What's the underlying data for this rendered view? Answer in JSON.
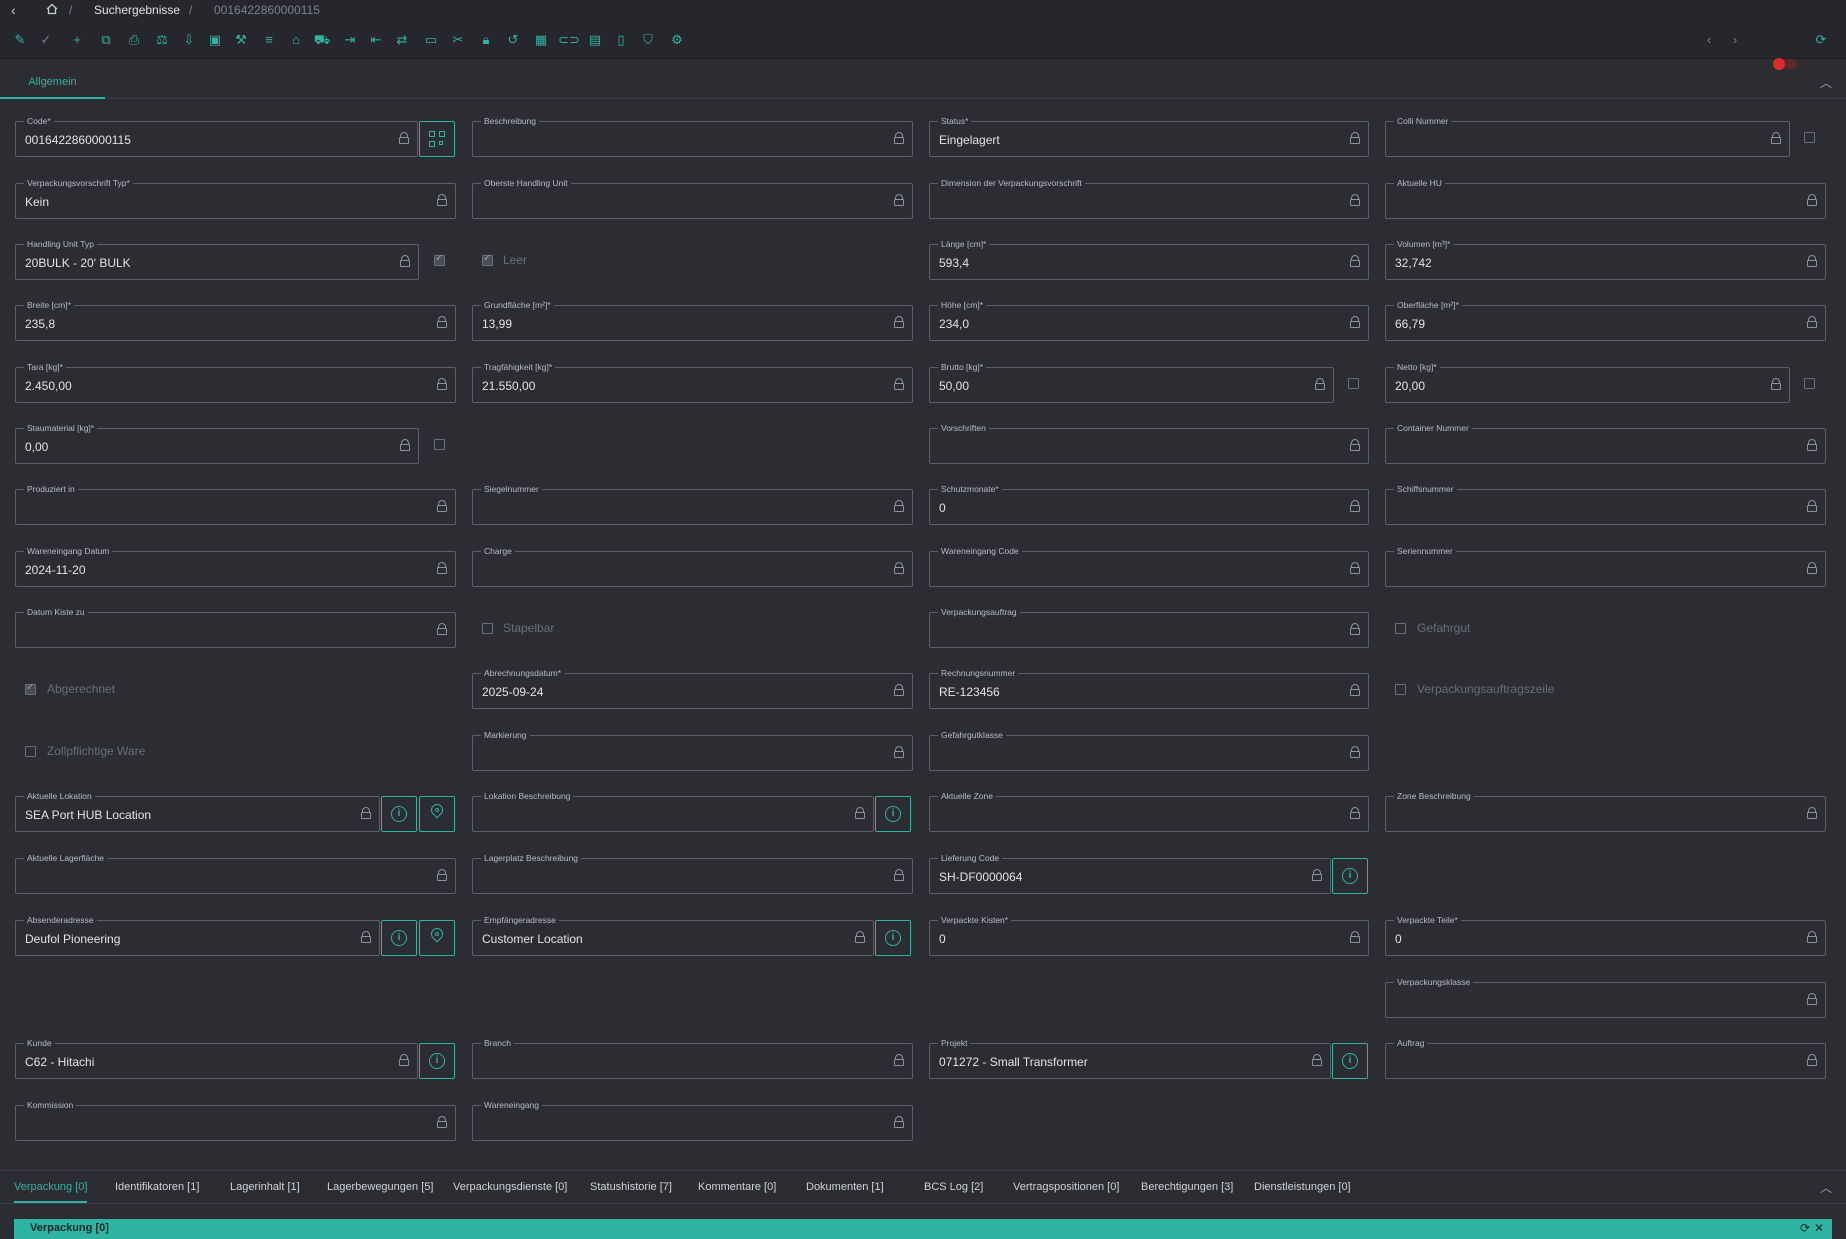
{
  "breadcrumb": {
    "results": "Suchergebnisse",
    "current": "0016422860000115"
  },
  "tabs": {
    "general": "Allgemein"
  },
  "icons": {
    "back": "chevron-left-icon",
    "home": "home-icon",
    "refresh": "refresh-icon",
    "lock": "lock-icon",
    "info": "info-icon",
    "location": "map-pin-icon",
    "qr": "qr-code-icon"
  },
  "colors": {
    "accent": "#2fb3a3",
    "background": "#2b2d33",
    "toggle_off": "#e02a2a"
  },
  "fields": {
    "code": {
      "label": "Code*",
      "value": "0016422860000115"
    },
    "beschreibung": {
      "label": "Beschreibung",
      "value": ""
    },
    "status": {
      "label": "Status*",
      "value": "Eingelagert"
    },
    "colli": {
      "label": "Colli Nummer",
      "value": ""
    },
    "vv_typ": {
      "label": "Verpackungsvorschrift Typ*",
      "value": "Kein"
    },
    "oberste_hu": {
      "label": "Oberste Handling Unit",
      "value": ""
    },
    "dim_vv": {
      "label": "Dimension der Verpackungsvorschrift",
      "value": ""
    },
    "aktuelle_hu": {
      "label": "Aktuelle HU",
      "value": ""
    },
    "hu_typ": {
      "label": "Handling Unit Typ",
      "value": "20BULK - 20' BULK"
    },
    "laenge": {
      "label": "Länge [cm]*",
      "value": "593,4"
    },
    "volumen": {
      "label": "Volumen [m³]*",
      "value": "32,742"
    },
    "breite": {
      "label": "Breite [cm]*",
      "value": "235,8"
    },
    "grundflaeche": {
      "label": "Grundfläche [m²]*",
      "value": "13,99"
    },
    "hoehe": {
      "label": "Höhe [cm]*",
      "value": "234,0"
    },
    "oberflaeche": {
      "label": "Oberfläche [m²]*",
      "value": "66,79"
    },
    "tara": {
      "label": "Tara [kg]*",
      "value": "2.450,00"
    },
    "tragfaehigkeit": {
      "label": "Tragfähigkeit [kg]*",
      "value": "21.550,00"
    },
    "brutto": {
      "label": "Brutto [kg]*",
      "value": "50,00"
    },
    "netto": {
      "label": "Netto [kg]*",
      "value": "20,00"
    },
    "staumaterial": {
      "label": "Staumaterial [kg]*",
      "value": "0,00"
    },
    "vorschriften": {
      "label": "Vorschriften",
      "value": ""
    },
    "container_nr": {
      "label": "Container Nummer",
      "value": ""
    },
    "produziert_in": {
      "label": "Produziert in",
      "value": ""
    },
    "siegelnummer": {
      "label": "Siegelnummer",
      "value": ""
    },
    "schutzmonate": {
      "label": "Schutzmonate*",
      "value": "0"
    },
    "schiffsnummer": {
      "label": "Schiffsnummer",
      "value": ""
    },
    "we_datum": {
      "label": "Wareneingang Datum",
      "value": "2024-11-20"
    },
    "charge": {
      "label": "Charge",
      "value": ""
    },
    "we_code": {
      "label": "Wareneingang Code",
      "value": ""
    },
    "seriennummer": {
      "label": "Seriennummer",
      "value": ""
    },
    "datum_kiste": {
      "label": "Datum Kiste zu",
      "value": ""
    },
    "verpackungsauftrag": {
      "label": "Verpackungsauftrag",
      "value": ""
    },
    "abrechnungsdatum": {
      "label": "Abrechnungsdatum*",
      "value": "2025-09-24"
    },
    "rechnungsnummer": {
      "label": "Rechnungsnummer",
      "value": "RE-123456"
    },
    "markierung": {
      "label": "Markierung",
      "value": ""
    },
    "gefahrgutklasse": {
      "label": "Gefahrgutklasse",
      "value": ""
    },
    "akt_lokation": {
      "label": "Aktuelle Lokation",
      "value": "SEA Port HUB Location"
    },
    "lok_beschreibung": {
      "label": "Lokation Beschreibung",
      "value": ""
    },
    "akt_zone": {
      "label": "Aktuelle Zone",
      "value": ""
    },
    "zone_beschreibung": {
      "label": "Zone Beschreibung",
      "value": ""
    },
    "akt_lagerflaeche": {
      "label": "Aktuelle Lagerfläche",
      "value": ""
    },
    "lagerplatz_beschr": {
      "label": "Lagerplatz Beschreibung",
      "value": ""
    },
    "lieferung_code": {
      "label": "Lieferung Code",
      "value": "SH-DF0000064"
    },
    "absender": {
      "label": "Absenderadresse",
      "value": "Deufol Pioneering"
    },
    "empfaenger": {
      "label": "Empfängeradresse",
      "value": "Customer Location"
    },
    "verpackte_kisten": {
      "label": "Verpackte Kisten*",
      "value": "0"
    },
    "verpackte_teile": {
      "label": "Verpackte Teile*",
      "value": "0"
    },
    "verpackungsklasse": {
      "label": "Verpackungsklasse",
      "value": ""
    },
    "kunde": {
      "label": "Kunde",
      "value": "C62 - Hitachi"
    },
    "branch": {
      "label": "Branch",
      "value": ""
    },
    "projekt": {
      "label": "Projekt",
      "value": "071272 - Small Transformer"
    },
    "auftrag": {
      "label": "Auftrag",
      "value": ""
    },
    "kommission": {
      "label": "Kommission",
      "value": ""
    },
    "wareneingang": {
      "label": "Wareneingang",
      "value": ""
    }
  },
  "checkboxes": {
    "leer": {
      "label": "Leer",
      "checked": true
    },
    "stapelbar": {
      "label": "Stapelbar",
      "checked": false
    },
    "gefahrgut": {
      "label": "Gefahrgut",
      "checked": false
    },
    "abgerechnet": {
      "label": "Abgerechnet",
      "checked": true
    },
    "vpa_zeile": {
      "label": "Verpackungsauftragszeile",
      "checked": false
    },
    "zoll": {
      "label": "Zollpflichtige Ware",
      "checked": false
    }
  },
  "bottom_tabs": [
    "Verpackung [0]",
    "Identifikatoren [1]",
    "Lagerinhalt [1]",
    "Lagerbewegungen [5]",
    "Verpackungsdienste [0]",
    "Statushistorie [7]",
    "Kommentare [0]",
    "Dokumenten [1]",
    "BCS Log [2]",
    "Vertragspositionen [0]",
    "Berechtigungen [3]",
    "Dienstleistungen [0]"
  ],
  "panel": {
    "title": "Verpackung [0]"
  }
}
